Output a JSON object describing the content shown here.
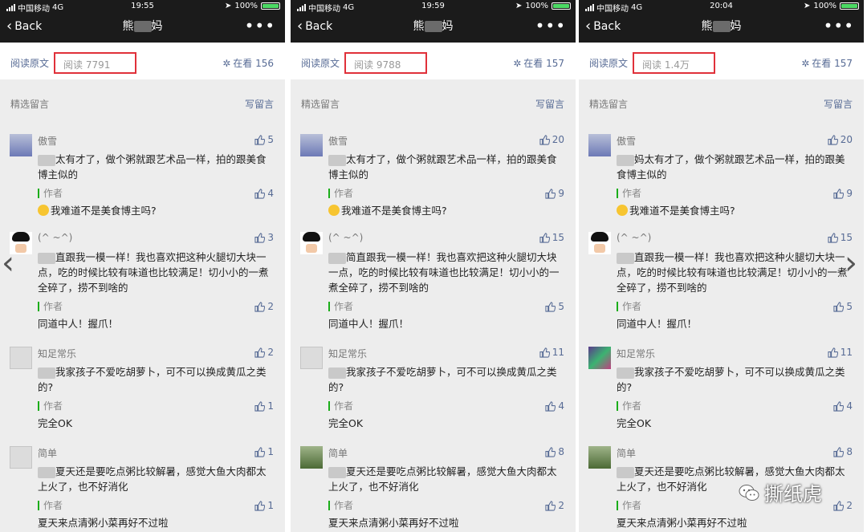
{
  "phones": [
    {
      "status": {
        "carrier": "中国移动",
        "network": "4G",
        "time": "19:55",
        "battery": "100%"
      },
      "nav": {
        "back": "Back",
        "title_left": "熊",
        "title_right": "妈",
        "more": "•••"
      },
      "stats": {
        "read_original": "阅读原文",
        "reads": "阅读 7791",
        "looking": "在看 156"
      },
      "comments_header": {
        "label": "精选留言",
        "write": "写留言"
      },
      "comments": [
        {
          "name": "傲雪",
          "likes": "5",
          "text": "太有才了，做个粥就跟艺术品一样，拍的跟美食博主似的",
          "author": "作者",
          "author_likes": "4",
          "reply": "我难道不是美食博主吗?"
        },
        {
          "name": "(^ ~^)",
          "likes": "3",
          "text": "直跟我一模一样！我也喜欢把这种火腿切大块一点，吃的时候比较有味道也比较满足！切小小的一煮全碎了，捞不到啥的",
          "author": "作者",
          "author_likes": "2",
          "reply": "同道中人！握爪！"
        },
        {
          "name": "知足常乐",
          "likes": "2",
          "text": "我家孩子不爱吃胡萝卜，可不可以换成黄瓜之类的?",
          "author": "作者",
          "author_likes": "1",
          "reply": "完全OK"
        },
        {
          "name": "简单",
          "likes": "1",
          "text": "夏天还是要吃点粥比较解暑，感觉大鱼大肉都太上火了，也不好消化",
          "author": "作者",
          "author_likes": "1",
          "reply": "夏天来点清粥小菜再好不过啦"
        }
      ]
    },
    {
      "status": {
        "carrier": "中国移动",
        "network": "4G",
        "time": "19:59",
        "battery": "100%"
      },
      "nav": {
        "back": "Back",
        "title_left": "熊",
        "title_right": "妈",
        "more": "•••"
      },
      "stats": {
        "read_original": "阅读原文",
        "reads": "阅读 9788",
        "looking": "在看 157"
      },
      "comments_header": {
        "label": "精选留言",
        "write": "写留言"
      },
      "comments": [
        {
          "name": "傲雪",
          "likes": "20",
          "text": "太有才了，做个粥就跟艺术品一样，拍的跟美食博主似的",
          "author": "作者",
          "author_likes": "9",
          "reply": "我难道不是美食博主吗?"
        },
        {
          "name": "(^ ~^)",
          "likes": "15",
          "text": "简直跟我一模一样！我也喜欢把这种火腿切大块一点，吃的时候比较有味道也比较满足！切小小的一煮全碎了，捞不到啥的",
          "author": "作者",
          "author_likes": "5",
          "reply": "同道中人！握爪！"
        },
        {
          "name": "知足常乐",
          "likes": "11",
          "text": "我家孩子不爱吃胡萝卜，可不可以换成黄瓜之类的?",
          "author": "作者",
          "author_likes": "4",
          "reply": "完全OK"
        },
        {
          "name": "简单",
          "likes": "8",
          "text": "夏天还是要吃点粥比较解暑，感觉大鱼大肉都太上火了，也不好消化",
          "author": "作者",
          "author_likes": "2",
          "reply": "夏天来点清粥小菜再好不过啦"
        }
      ]
    },
    {
      "status": {
        "carrier": "中国移动",
        "network": "4G",
        "time": "20:04",
        "battery": "100%"
      },
      "nav": {
        "back": "Back",
        "title_left": "熊",
        "title_right": "妈",
        "more": "•••"
      },
      "stats": {
        "read_original": "阅读原文",
        "reads": "阅读 1.4万",
        "looking": "在看 157"
      },
      "comments_header": {
        "label": "精选留言",
        "write": "写留言"
      },
      "comments": [
        {
          "name": "傲雪",
          "likes": "20",
          "text": "妈太有才了，做个粥就跟艺术品一样，拍的跟美食博主似的",
          "author": "作者",
          "author_likes": "9",
          "reply": "我难道不是美食博主吗?"
        },
        {
          "name": "(^ ~^)",
          "likes": "15",
          "text": "直跟我一模一样！我也喜欢把这种火腿切大块一点，吃的时候比较有味道也比较满足！切小小的一煮全碎了，捞不到啥的",
          "author": "作者",
          "author_likes": "5",
          "reply": "同道中人！握爪！"
        },
        {
          "name": "知足常乐",
          "likes": "11",
          "text": "我家孩子不爱吃胡萝卜，可不可以换成黄瓜之类的?",
          "author": "作者",
          "author_likes": "4",
          "reply": "完全OK"
        },
        {
          "name": "简单",
          "likes": "8",
          "text": "夏天还是要吃点粥比较解暑，感觉大鱼大肉都太上火了，也不好消化",
          "author": "作者",
          "author_likes": "2",
          "reply": "夏天来点清粥小菜再好不过啦"
        }
      ]
    }
  ],
  "arrows": {
    "left": "‹",
    "right": "›"
  },
  "watermark": "撕纸虎",
  "colors": {
    "link": "#576b95",
    "highlight_box": "#e0313a",
    "author_bar": "#1aad19"
  }
}
